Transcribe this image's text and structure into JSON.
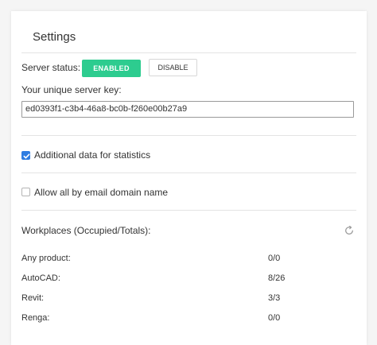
{
  "settings": {
    "title": "Settings",
    "server_status_label": "Server status:",
    "enabled_label": "ENABLED",
    "disable_label": "DISABLE",
    "server_key_label": "Your unique server key:",
    "server_key_value": "ed0393f1-c3b4-46a8-bc0b-f260e00b27a9",
    "additional_data_label": "Additional data for statistics",
    "additional_data_checked": true,
    "allow_email_label": "Allow all by email domain name",
    "allow_email_checked": false,
    "workplaces_label": "Workplaces (Occupied/Totals):",
    "refresh_icon": "refresh-icon",
    "workplaces": [
      {
        "product": "Any product:",
        "value": "0/0"
      },
      {
        "product": "AutoCAD:",
        "value": "8/26"
      },
      {
        "product": "Revit:",
        "value": "3/3"
      },
      {
        "product": "Renga:",
        "value": "0/0"
      }
    ]
  },
  "colors": {
    "enabled_button": "#2dcc8f",
    "checkbox_checked": "#2f7de1",
    "divider": "#e3e3e3"
  }
}
